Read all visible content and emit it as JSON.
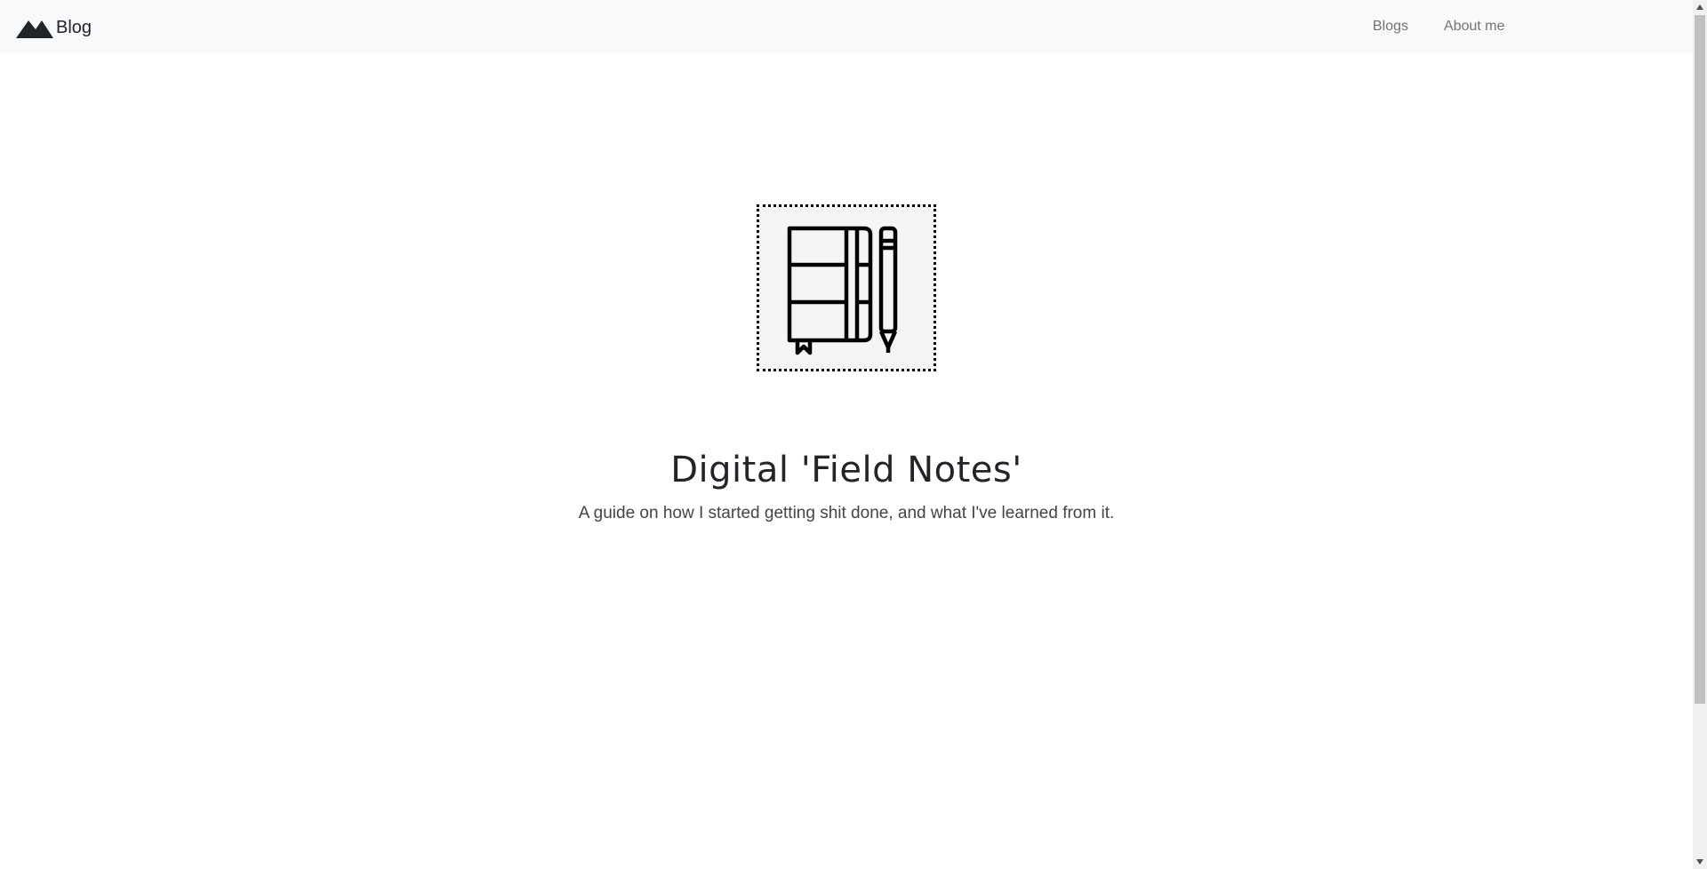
{
  "navbar": {
    "brand": {
      "logo_icon": "mountain-icon",
      "label": "Blog"
    },
    "links": [
      {
        "label": "Blogs"
      },
      {
        "label": "About me"
      }
    ],
    "background": "#f8f9fa"
  },
  "hero": {
    "image_icon": "notebook-and-pencil-icon",
    "title": "Digital 'Field Notes'",
    "subtitle": "A guide on how I started getting shit done, and what I've learned from it."
  },
  "colors": {
    "text": "#212529",
    "nav_link": "#737373",
    "subtitle": "#444444"
  }
}
